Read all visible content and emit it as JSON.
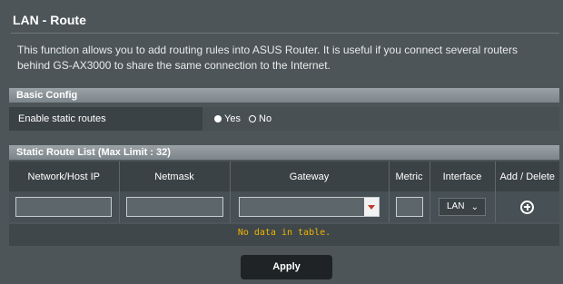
{
  "page": {
    "title": "LAN - Route",
    "description": "This function allows you to add routing rules into ASUS Router. It is useful if you connect several routers behind GS-AX3000 to share the same connection to the Internet."
  },
  "basic_config": {
    "header": "Basic Config",
    "enable_label": "Enable static routes",
    "yes_label": "Yes",
    "no_label": "No",
    "selected": "Yes"
  },
  "route_list": {
    "header": "Static Route List (Max Limit : 32)",
    "columns": [
      "Network/Host IP",
      "Netmask",
      "Gateway",
      "Metric",
      "Interface",
      "Add / Delete"
    ],
    "interface_value": "LAN",
    "empty_message": "No data in table."
  },
  "apply_label": "Apply",
  "colors": {
    "background": "#4d5558",
    "section_bar": "#8b9397",
    "empty_text": "#f0b400",
    "dropdown_arrow": "#c0392b"
  }
}
